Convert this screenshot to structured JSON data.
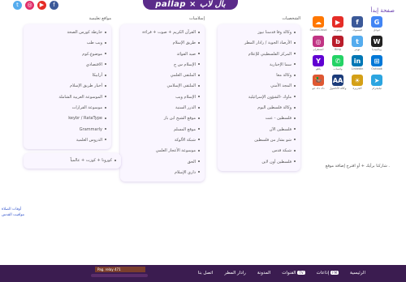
{
  "header": {
    "logo_text": "pallap × بال لاب",
    "page_title": "صفحة إبدأ",
    "social": [
      {
        "name": "twitter-icon",
        "color": "#55acee",
        "glyph": "t"
      },
      {
        "name": "instagram-icon",
        "color": "#e1306c",
        "glyph": "◎"
      },
      {
        "name": "youtube-icon",
        "color": "#e52d27",
        "glyph": "▶"
      },
      {
        "name": "facebook-icon",
        "color": "#3b5998",
        "glyph": "f"
      }
    ]
  },
  "columns": {
    "news": {
      "heading": "الشخصيات",
      "items": [
        "وكالة وفا قدسنا نيوز",
        "الأرصاد الجوية / رادار المطر",
        "المركز الفلسطيني للإعلام",
        "سما الإخبارية",
        "وكالة معا",
        "المجد الأمني",
        "ماوك -الشؤون الإسرائيلية",
        "وكالة فلسطين اليوم",
        "فلسطين - عنت",
        "فلسطين الآن",
        "شو بشار من فلسطين",
        "شبكة قدس",
        "فلسطين أون لاين"
      ]
    },
    "islamic": {
      "heading": "إسلاميات",
      "items": [
        "القرآن الكريم + صوت + قراءة",
        "طريق الإسلام",
        "صيد الفوائد",
        "الإسلام س ج",
        "الملتقى العلمي",
        "الملتقى الإسلامي",
        "الإسلام ويب",
        "الدرر السنية",
        "موقع الشيخ ابن باز",
        "موقع المسلم",
        "شبكة الألوكة",
        "موسوعة الأعجاز العلمي",
        "الحق",
        "داري الإسلام"
      ]
    },
    "general": {
      "heading": "مواقع تعليمية",
      "items": [
        "خارطة كورس الصحة",
        "ويب طب",
        "موضوع.كوم",
        "الاقتصادي",
        "أرابيكا",
        "أخبار طريق الإسلام",
        "الموسوعة العربية الشاملة",
        "موسوعة القرارات",
        "keybr / RataType",
        "Grammarly",
        "الدروس العلمية"
      ]
    },
    "extra_box": {
      "item": "كورونا + كوزت + عالمياً"
    }
  },
  "apps": [
    {
      "name": "google-icon",
      "label": "جوجل",
      "color": "#4285f4",
      "glyph": "G"
    },
    {
      "name": "facebook-app-icon",
      "label": "فيسبوك",
      "color": "#3b5998",
      "glyph": "f"
    },
    {
      "name": "youtube-app-icon",
      "label": "يوتيوب",
      "color": "#e52d27",
      "glyph": "▶"
    },
    {
      "name": "soundcloud-icon",
      "label": "SoundCloud",
      "color": "#ff7700",
      "glyph": "☁"
    },
    {
      "name": "wikipedia-icon",
      "label": "ويكيبيديا",
      "color": "#222222",
      "glyph": "W"
    },
    {
      "name": "twitter-app-icon",
      "label": "تويتر",
      "color": "#55acee",
      "glyph": "t"
    },
    {
      "name": "bing-icon",
      "label": "Bing",
      "color": "#b91d2b",
      "glyph": "b"
    },
    {
      "name": "instagram-app-icon",
      "label": "انستغرام",
      "color": "#c13584",
      "glyph": "◎"
    },
    {
      "name": "windows-icon",
      "label": "Outlook",
      "color": "#0078d7",
      "glyph": "⊞"
    },
    {
      "name": "linkedin-icon",
      "label": "Linkedin",
      "color": "#0077b5",
      "glyph": "in"
    },
    {
      "name": "whatsapp-icon",
      "label": "واتساب",
      "color": "#25d366",
      "glyph": "✆"
    },
    {
      "name": "yahoo-icon",
      "label": "ياهو",
      "color": "#6001d2",
      "glyph": "Y"
    },
    {
      "name": "telegram-icon",
      "label": "تيليجرام",
      "color": "#2ca5e0",
      "glyph": "➤"
    },
    {
      "name": "aljazeera-icon",
      "label": "الجزيرة",
      "color": "#d4a017",
      "glyph": "☀"
    },
    {
      "name": "anadolu-icon",
      "label": "وكالة الأناضول",
      "color": "#1c3c7a",
      "glyph": "AA"
    },
    {
      "name": "duckduckgo-icon",
      "label": "دك دك جو",
      "color": "#de5833",
      "glyph": "🦆"
    }
  ],
  "note": "شاركنا برأيك + أو اقترح إضافة موقع .",
  "left_links": [
    "أوقات الصلاة",
    "مواقيت القدس"
  ],
  "ticker": {
    "text": "Pag. relay 471"
  },
  "bottom_nav": [
    {
      "label": "الرئيسية"
    },
    {
      "label": "إذاعات",
      "badge": "FM"
    },
    {
      "label": "القنوات",
      "badge": "TV"
    },
    {
      "label": "المدونة"
    },
    {
      "label": "رادار المطر"
    },
    {
      "label": "اتصل بنا"
    }
  ]
}
